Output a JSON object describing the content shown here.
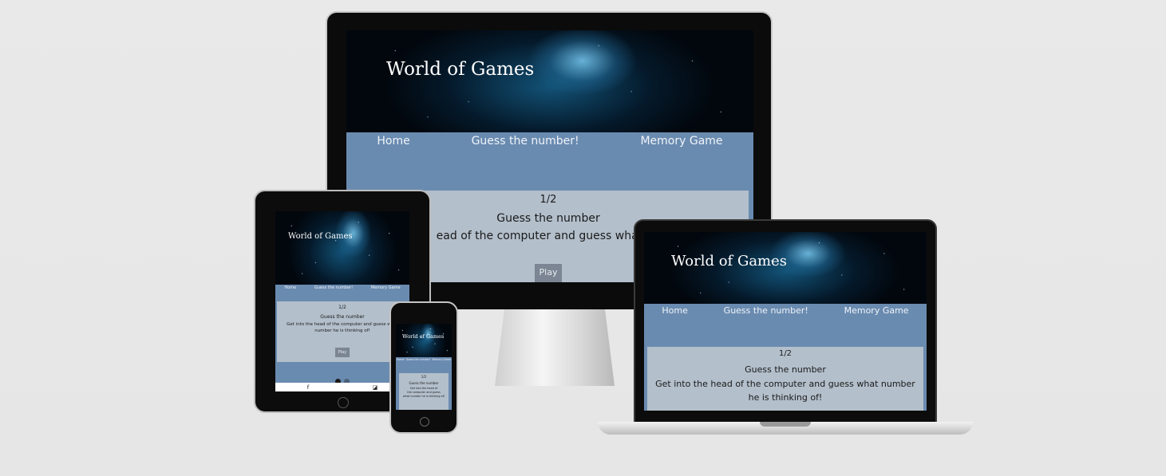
{
  "site": {
    "title": "World of Games",
    "nav": [
      "Home",
      "Guess the number!",
      "Memory Game"
    ],
    "progress": "1/2",
    "game_title": "Guess the number",
    "description": "Get into the head of the computer and guess what number he is thinking of!",
    "play_label": "Play"
  },
  "monitor": {
    "description_visible": "ead of the computer and guess what nu"
  },
  "tablet": {
    "description_line1": "Get into the head of the computer and guess what",
    "description_line2": "number he is thinking of!",
    "social": [
      "f",
      "◪"
    ]
  },
  "phone": {
    "nav": [
      "Home",
      "Guess the number!",
      "Memory Game"
    ],
    "description_line1": "Get into the head of",
    "description_line2": "the computer and guess",
    "description_line3": "what number he is thinking of!"
  },
  "laptop": {
    "description_line1": "Get into the head of the computer and guess what number",
    "description_line2": "he is thinking of!"
  },
  "colors": {
    "nav_blue": "#6a8bb0",
    "card_gray": "#b3bfcb",
    "button_gray": "#7b8593",
    "page_bg": "#e8e8e8"
  }
}
